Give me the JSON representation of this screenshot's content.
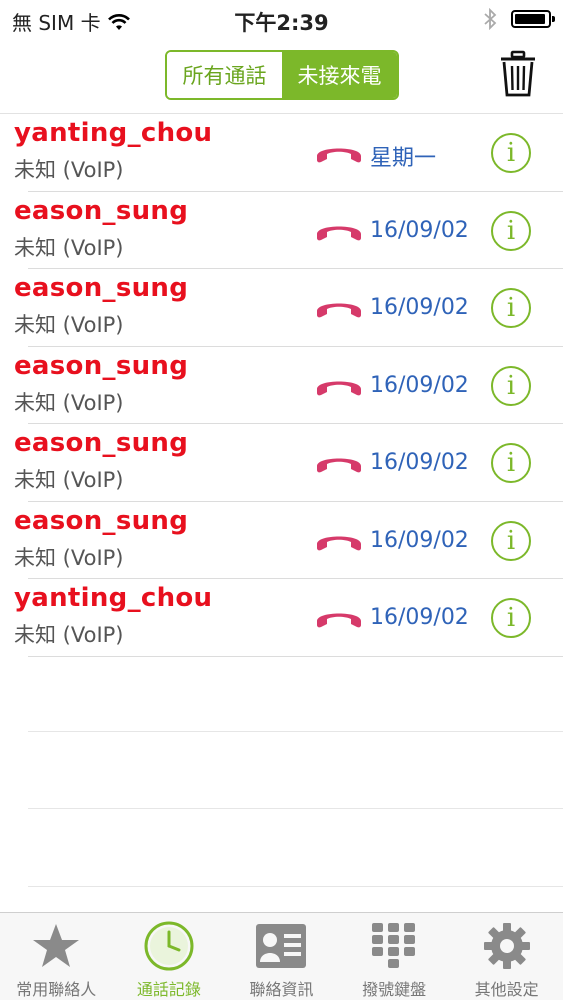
{
  "status_bar": {
    "carrier": "無 SIM 卡",
    "time": "下午2:39"
  },
  "header": {
    "segments": [
      {
        "label": "所有通話",
        "selected": false
      },
      {
        "label": "未接來電",
        "selected": true
      }
    ],
    "trash_icon": "trash-icon"
  },
  "calls": [
    {
      "name": "yanting_chou",
      "type": "未知 (VoIP)",
      "date": "星期一"
    },
    {
      "name": "eason_sung",
      "type": "未知 (VoIP)",
      "date": "16/09/02"
    },
    {
      "name": "eason_sung",
      "type": "未知 (VoIP)",
      "date": "16/09/02"
    },
    {
      "name": "eason_sung",
      "type": "未知 (VoIP)",
      "date": "16/09/02"
    },
    {
      "name": "eason_sung",
      "type": "未知 (VoIP)",
      "date": "16/09/02"
    },
    {
      "name": "eason_sung",
      "type": "未知 (VoIP)",
      "date": "16/09/02"
    },
    {
      "name": "yanting_chou",
      "type": "未知 (VoIP)",
      "date": "16/09/02"
    }
  ],
  "tabbar": {
    "items": [
      {
        "label": "常用聯絡人",
        "icon": "star-icon",
        "active": false
      },
      {
        "label": "通話記錄",
        "icon": "clock-icon",
        "active": true
      },
      {
        "label": "聯絡資訊",
        "icon": "contact-card-icon",
        "active": false
      },
      {
        "label": "撥號鍵盤",
        "icon": "keypad-icon",
        "active": false
      },
      {
        "label": "其他設定",
        "icon": "gear-icon",
        "active": false
      }
    ]
  },
  "colors": {
    "accent": "#7cb82a",
    "missed_name": "#e8101e",
    "date": "#2f63b8",
    "phone_icon": "#d63a6a"
  }
}
